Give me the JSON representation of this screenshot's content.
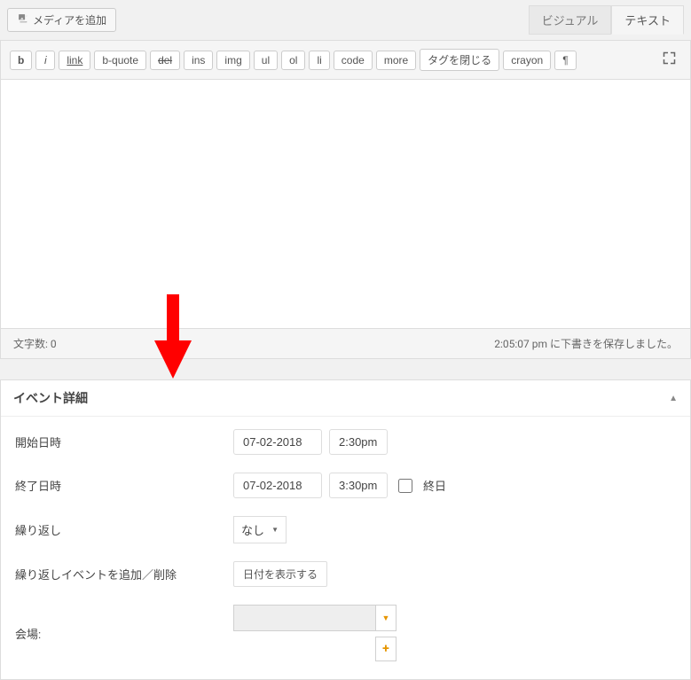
{
  "media_button": {
    "label": "メディアを追加",
    "icon": "add-media"
  },
  "editor_tabs": {
    "visual": "ビジュアル",
    "text": "テキスト",
    "active": "text"
  },
  "toolbar": {
    "buttons": [
      "b",
      "i",
      "link",
      "b-quote",
      "del",
      "ins",
      "img",
      "ul",
      "ol",
      "li",
      "code",
      "more",
      "タグを閉じる",
      "crayon",
      "¶"
    ]
  },
  "word_count": {
    "label": "文字数:",
    "value": "0"
  },
  "save_status": "2:05:07 pm に下書きを保存しました。",
  "panel": {
    "title": "イベント詳細",
    "fields": {
      "start": {
        "label": "開始日時",
        "date": "07-02-2018",
        "time": "2:30pm"
      },
      "end": {
        "label": "終了日時",
        "date": "07-02-2018",
        "time": "3:30pm",
        "allday_label": "終日"
      },
      "repeat": {
        "label": "繰り返し",
        "value": "なし"
      },
      "repeat_events": {
        "label": "繰り返しイベントを追加／削除",
        "button": "日付を表示する"
      },
      "venue": {
        "label": "会場:"
      }
    }
  }
}
